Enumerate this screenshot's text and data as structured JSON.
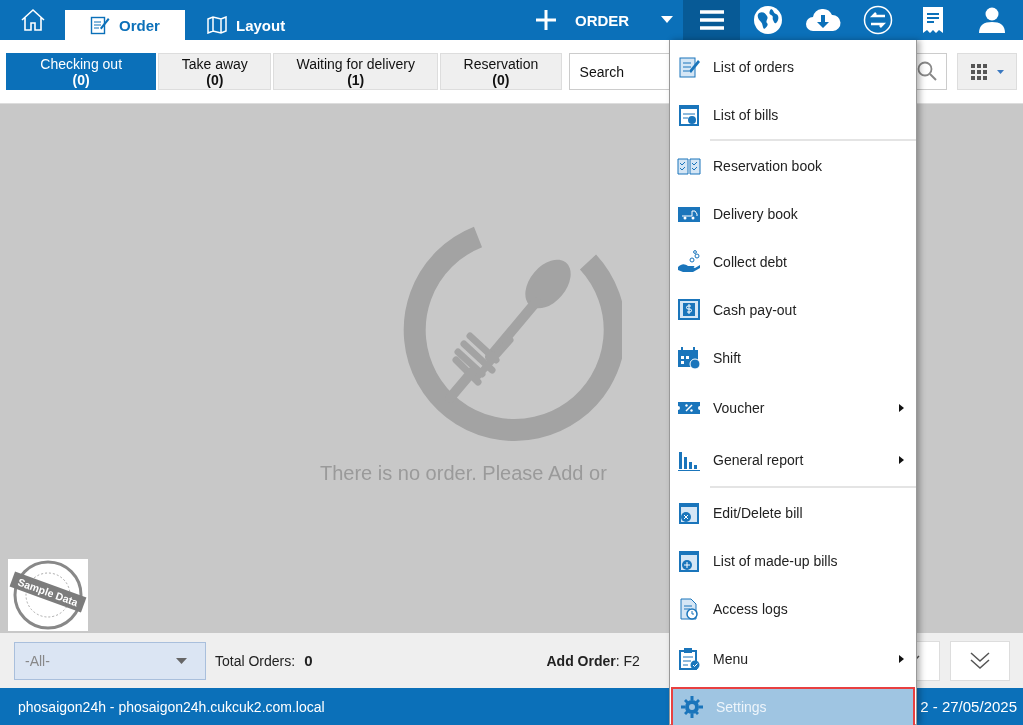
{
  "top_bar": {
    "tabs": [
      {
        "label": "Order",
        "selected": true
      },
      {
        "label": "Layout",
        "selected": false
      }
    ],
    "add_order_button": {
      "label": "ORDER"
    },
    "menu_button": {
      "expanded": true
    }
  },
  "filter_tabs": [
    {
      "label": "Checking out",
      "count": "(0)",
      "selected": true
    },
    {
      "label": "Take away",
      "count": "(0)",
      "selected": false
    },
    {
      "label": "Waiting for delivery",
      "count": "(1)",
      "selected": false
    },
    {
      "label": "Reservation",
      "count": "(0)",
      "selected": false
    }
  ],
  "search": {
    "placeholder": "Search"
  },
  "empty_message": "There is no order. Please Add or",
  "sample_badge": "Sample Data",
  "footer": {
    "filter": {
      "value": "-All-"
    },
    "total_label": "Total Orders:",
    "total_value": "0",
    "shortcut": "**Add Order**: F2"
  },
  "status_bar": {
    "left": "phosaigon24h - phosaigon24h.cukcuk2.com.local",
    "right": "2 - 27/05/2025"
  },
  "menu": {
    "sections": [
      {
        "items": [
          {
            "label": "List of orders",
            "submenu": false,
            "selected": false
          },
          {
            "label": "List of bills",
            "submenu": false,
            "selected": false
          }
        ]
      },
      {
        "items": [
          {
            "label": "Reservation book",
            "submenu": false,
            "selected": false
          },
          {
            "label": "Delivery book",
            "submenu": false,
            "selected": false
          },
          {
            "label": "Collect debt",
            "submenu": false,
            "selected": false
          },
          {
            "label": "Cash pay-out",
            "submenu": false,
            "selected": false
          },
          {
            "label": "Shift",
            "submenu": false,
            "selected": false
          },
          {
            "label": "Voucher",
            "submenu": true,
            "selected": false
          },
          {
            "label": "General report",
            "submenu": true,
            "selected": false
          }
        ]
      },
      {
        "items": [
          {
            "label": "Edit/Delete bill",
            "submenu": false,
            "selected": false
          },
          {
            "label": "List of made-up bills",
            "submenu": false,
            "selected": false
          },
          {
            "label": "Access logs",
            "submenu": false,
            "selected": false
          },
          {
            "label": "Menu",
            "submenu": true,
            "selected": false
          },
          {
            "label": "Settings",
            "submenu": false,
            "selected": true
          }
        ]
      }
    ]
  }
}
